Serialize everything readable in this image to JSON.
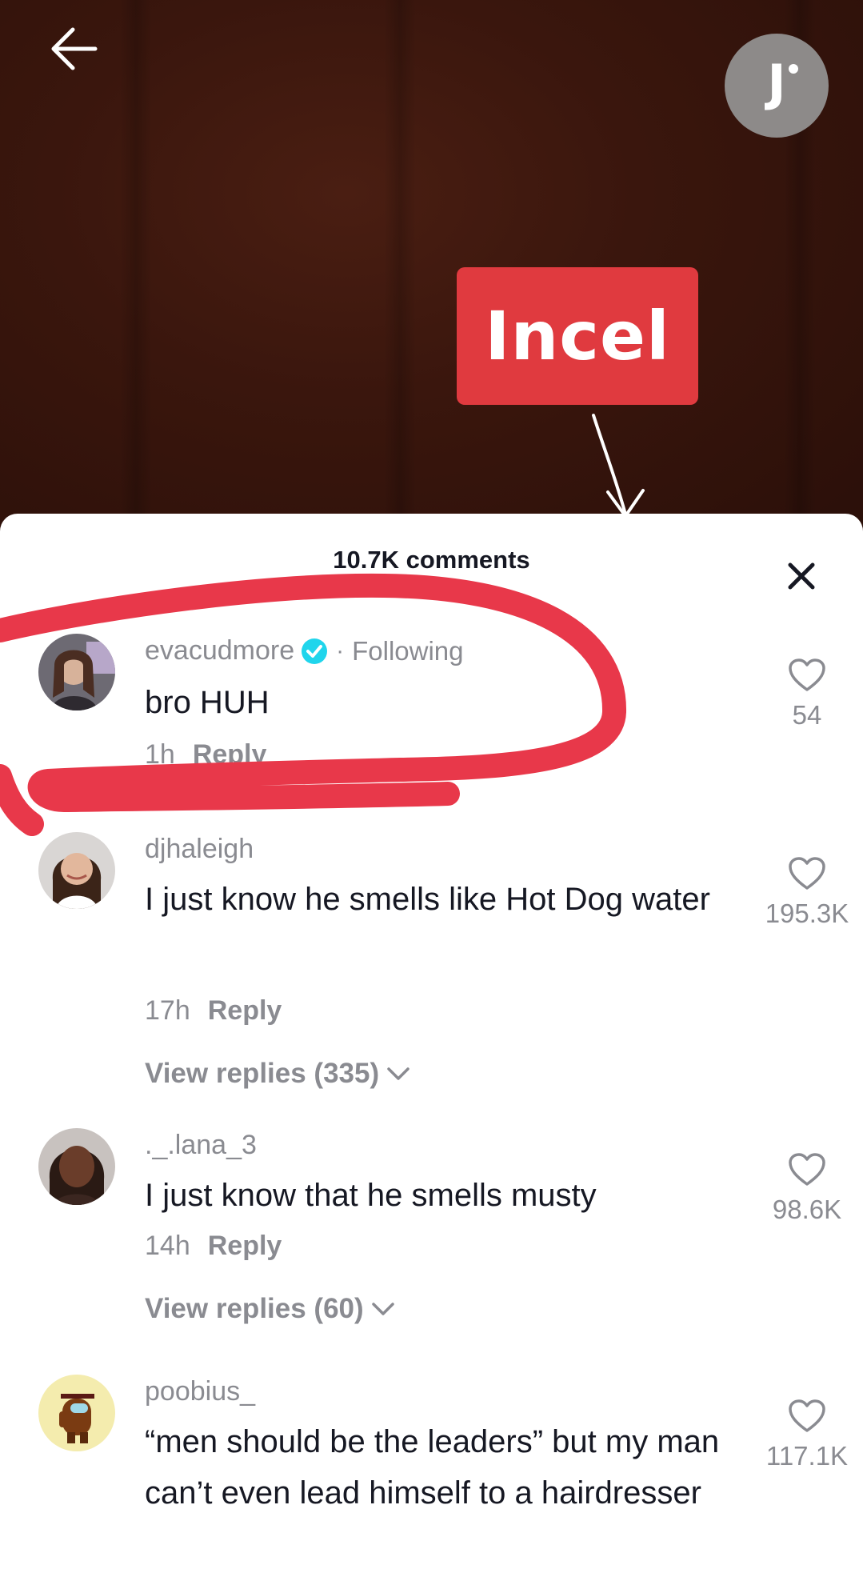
{
  "video": {
    "sticker_text": "Incel",
    "creator_badge_letter": "J"
  },
  "sheet": {
    "title": "10.7K comments"
  },
  "colors": {
    "sticker_red": "#e03a3f",
    "scribble_red": "#e8384a",
    "verified_blue": "#20d5ec",
    "text_primary": "#161823",
    "text_secondary": "#8a8b91"
  },
  "comments": [
    {
      "username": "evacudmore",
      "verified": true,
      "following_label": "Following",
      "text": "bro HUH",
      "time": "1h",
      "reply_label": "Reply",
      "likes": "54",
      "view_replies": ""
    },
    {
      "username": "djhaleigh",
      "verified": false,
      "following_label": "",
      "text": "I just know he smells like Hot Dog water",
      "time": "17h",
      "reply_label": "Reply",
      "likes": "195.3K",
      "view_replies": "View replies (335)"
    },
    {
      "username": "._.lana_3",
      "verified": false,
      "following_label": "",
      "text": "I just know that he smells musty",
      "time": "14h",
      "reply_label": "Reply",
      "likes": "98.6K",
      "view_replies": "View replies (60)"
    },
    {
      "username": "poobius_",
      "verified": false,
      "following_label": "",
      "text": "“men should be the leaders” but my man can’t even lead himself to a hairdresser",
      "time": "",
      "reply_label": "",
      "likes": "117.1K",
      "view_replies": ""
    }
  ]
}
